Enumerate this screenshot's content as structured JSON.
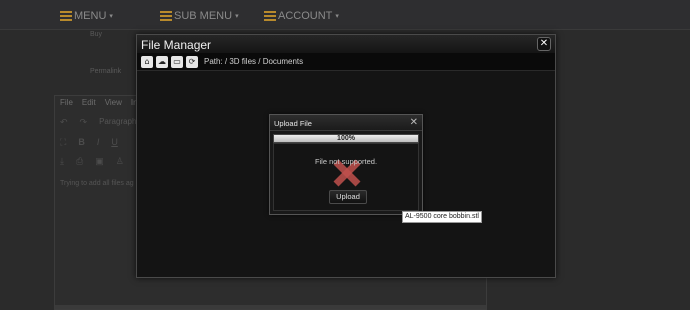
{
  "nav": {
    "menu_label": "MENU",
    "submenu_label": "SUB MENU",
    "account_label": "ACCOUNT",
    "caret": "▾"
  },
  "background": {
    "faded_top_text": "Buy",
    "permalink_text": "Permalink",
    "editor": {
      "menu_items": [
        "File",
        "Edit",
        "View",
        "Ins"
      ],
      "format_label": "Paragraph",
      "placeholder": "Trying to add all files ag"
    }
  },
  "file_manager": {
    "title": "File Manager",
    "close_glyph": "✕",
    "path": "Path: / 3D files / Documents"
  },
  "upload_dialog": {
    "title": "Upload File",
    "close_glyph": "✕",
    "progress_text": "100%",
    "progress_fraction": 1.0,
    "message": "File not supported.",
    "upload_button": "Upload"
  },
  "tooltip": {
    "text": "AL-9500 core bobbin.stl"
  },
  "colors": {
    "accent": "#b88a2c",
    "error_mark": "#c0504d"
  }
}
